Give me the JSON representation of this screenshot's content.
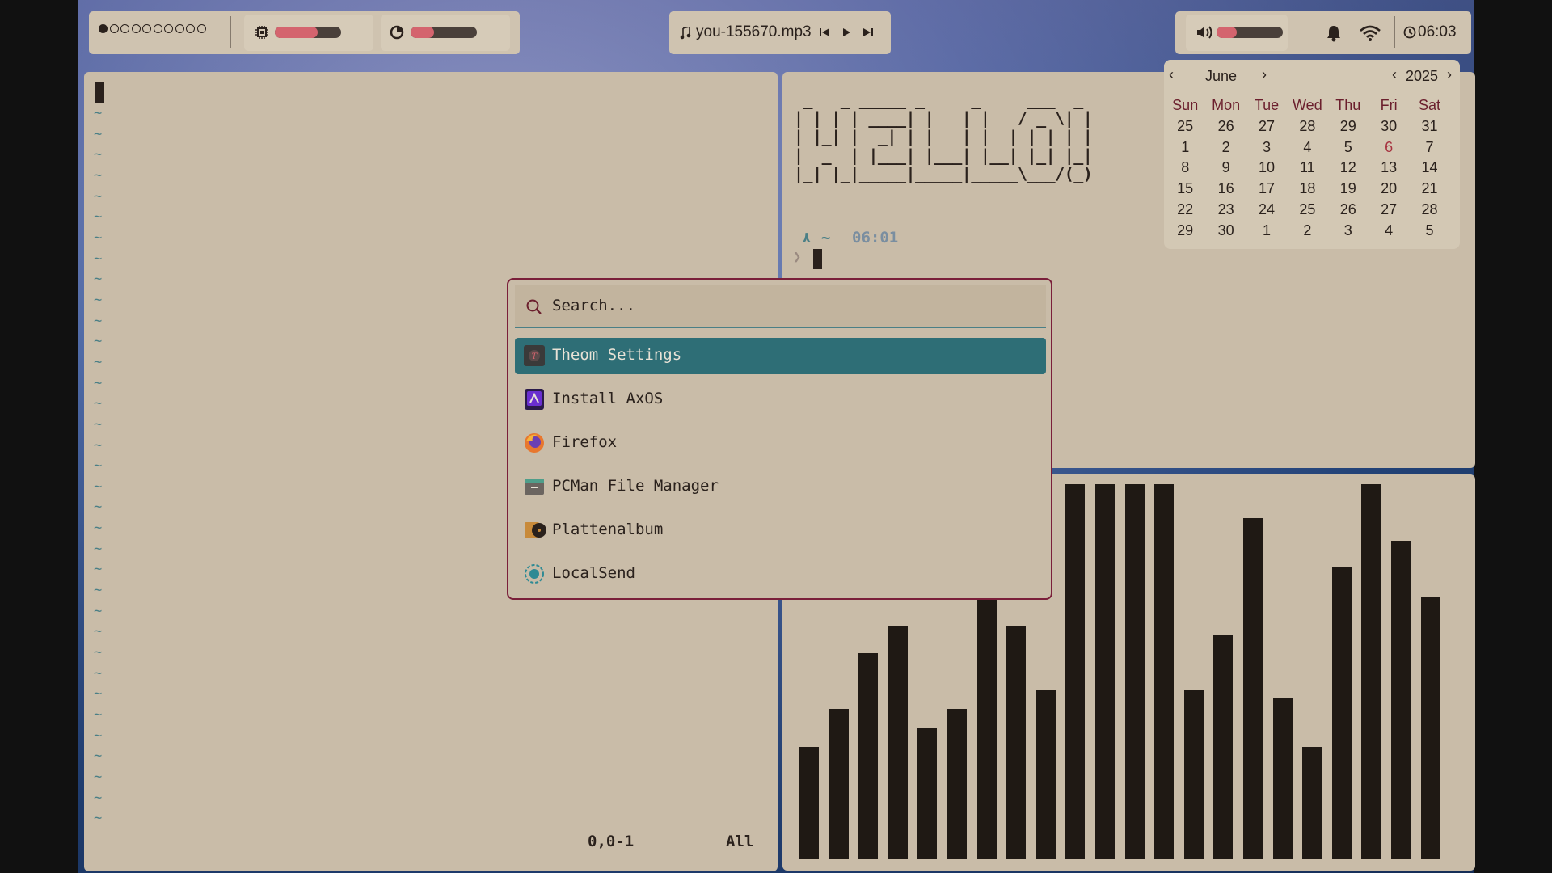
{
  "topbar": {
    "media_title": "you-155670.mp3",
    "clock": "06:03",
    "cpu_level_percent": 65,
    "ram_level_percent": 35,
    "volume_level_percent": 30
  },
  "vim": {
    "tilde": "~",
    "position": "0,0-1",
    "scroll": "All"
  },
  "terminal": {
    "prompt_arrow": "⋏",
    "cwd": "~",
    "time": "06:01",
    "prompt_char": "❯",
    "ascii_art_lines": [
      " _   _ _____ _     _     ___  _ ",
      "| | | | ____| |   | |   / _ \\| |",
      "| |_| |  _| | |   | |  | | | | |",
      "|  _  | |___| |___| |__| |_| |_|",
      "|_| |_|_____|_____|_____\\___/(_)"
    ]
  },
  "calendar": {
    "month": "June",
    "year": "2025",
    "weekdays": [
      "Sun",
      "Mon",
      "Tue",
      "Wed",
      "Thu",
      "Fri",
      "Sat"
    ],
    "days": [
      "25",
      "26",
      "27",
      "28",
      "29",
      "30",
      "31",
      "1",
      "2",
      "3",
      "4",
      "5",
      "6",
      "7",
      "8",
      "9",
      "10",
      "11",
      "12",
      "13",
      "14",
      "15",
      "16",
      "17",
      "18",
      "19",
      "20",
      "21",
      "22",
      "23",
      "24",
      "25",
      "26",
      "27",
      "28",
      "29",
      "30",
      "1",
      "2",
      "3",
      "4",
      "5"
    ],
    "selected_index": 12
  },
  "launcher": {
    "search_placeholder": "Search...",
    "items": [
      {
        "label": "Theom Settings",
        "icon": "theom-settings-icon",
        "selected": true
      },
      {
        "label": "Install AxOS",
        "icon": "axos-installer-icon",
        "selected": false
      },
      {
        "label": "Firefox",
        "icon": "firefox-icon",
        "selected": false
      },
      {
        "label": "PCMan File Manager",
        "icon": "file-manager-icon",
        "selected": false
      },
      {
        "label": "Plattenalbum",
        "icon": "music-player-icon",
        "selected": false
      },
      {
        "label": "LocalSend",
        "icon": "localsend-icon",
        "selected": false
      }
    ]
  },
  "visualizer": {
    "levels": [
      0.3,
      0.4,
      0.55,
      0.62,
      0.35,
      0.4,
      0.72,
      0.62,
      0.45,
      1.0,
      1.0,
      1.0,
      1.0,
      0.45,
      0.6,
      0.91,
      0.43,
      0.3,
      0.78,
      1.0,
      0.85,
      0.7
    ]
  },
  "colors": {
    "panel": "#c9bca8",
    "text": "#2a211c",
    "accent_teal": "#2e6e76",
    "accent_red": "#d4646e",
    "launcher_border": "#7a1f3a"
  }
}
